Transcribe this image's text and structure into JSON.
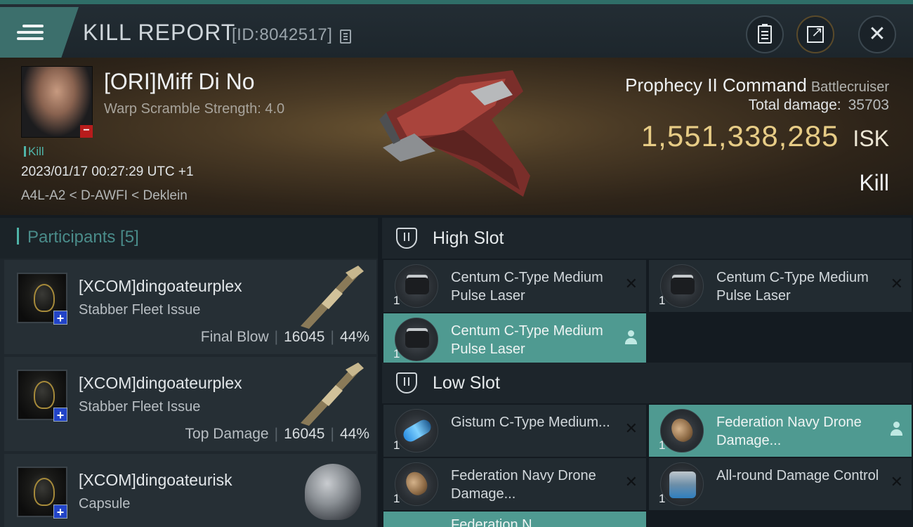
{
  "header": {
    "title": "KILL REPORT",
    "id_label": "[ID:8042517]",
    "menu_icon": "hamburger-icon",
    "actions": [
      "clipboard-icon",
      "share-icon",
      "close-icon"
    ]
  },
  "victim": {
    "name": "[ORI]Miff Di No",
    "warp_scramble": "Warp Scramble Strength: 4.0",
    "status_tag": "Kill",
    "datetime": "2023/01/17 00:27:29 UTC +1",
    "location": "A4L-A2 < D-AWFI < Deklein"
  },
  "ship": {
    "name": "Prophecy II Command",
    "class": "Battlecruiser",
    "total_damage_label": "Total damage:",
    "total_damage": "35703",
    "isk_value": "1,551,338,285",
    "isk_unit": "ISK",
    "result": "Kill"
  },
  "participants": {
    "header": "Participants [5]",
    "items": [
      {
        "name": "[XCOM]dingoateurplex",
        "ship": "Stabber Fleet Issue",
        "label": "Final Blow",
        "damage": "16045",
        "percent": "44%"
      },
      {
        "name": "[XCOM]dingoateurplex",
        "ship": "Stabber Fleet Issue",
        "label": "Top Damage",
        "damage": "16045",
        "percent": "44%"
      },
      {
        "name": "[XCOM]dingoateurisk",
        "ship": "Capsule"
      }
    ]
  },
  "fittings": {
    "high_slot_title": "High Slot",
    "low_slot_title": "Low Slot",
    "high": [
      {
        "name": "Centum C-Type Medium Pulse Laser",
        "qty": "1",
        "status": "destroyed"
      },
      {
        "name": "Centum C-Type Medium Pulse Laser",
        "qty": "1",
        "status": "destroyed"
      },
      {
        "name": "Centum C-Type Medium Pulse Laser",
        "qty": "1",
        "status": "dropped"
      }
    ],
    "low": [
      {
        "name": "Gistum C-Type Medium...",
        "qty": "1",
        "status": "destroyed"
      },
      {
        "name": "Federation Navy Drone Damage...",
        "qty": "1",
        "status": "dropped"
      },
      {
        "name": "Federation Navy Drone Damage...",
        "qty": "1",
        "status": "destroyed"
      },
      {
        "name": "All-round Damage Control",
        "qty": "1",
        "status": "destroyed"
      },
      {
        "name": "Federation N...",
        "qty": "",
        "status": "dropped"
      }
    ]
  },
  "colors": {
    "accent_teal": "#4fb4a8",
    "dropped_row": "#4f9a91",
    "isk_gold": "#e7cc86",
    "header_teal": "#3c6f6c"
  }
}
